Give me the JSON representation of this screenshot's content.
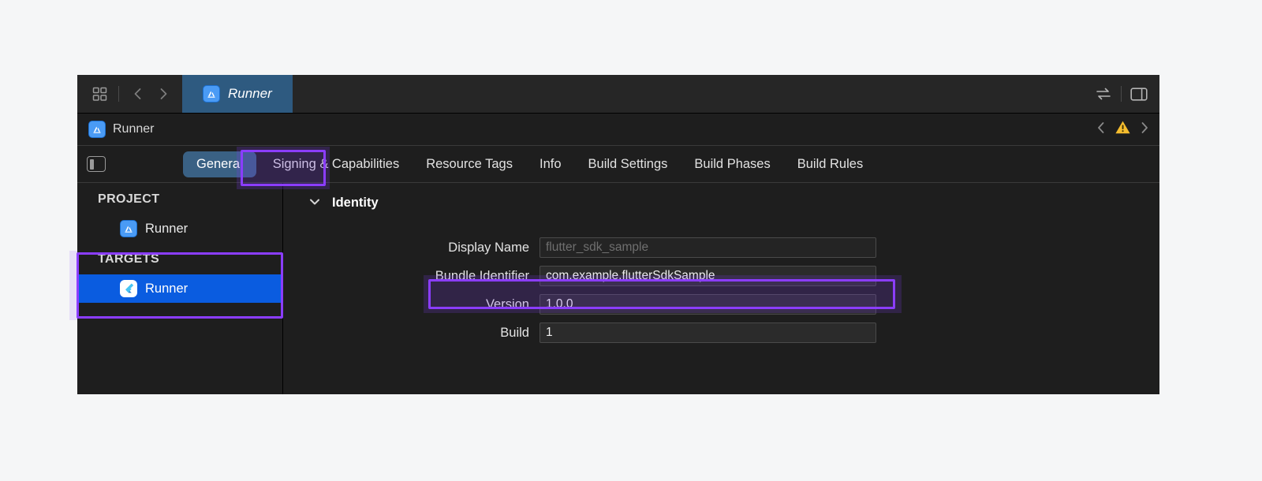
{
  "toolbar": {
    "panels_icon": "panels-grid-icon",
    "back_icon": "chevron-left-icon",
    "forward_icon": "chevron-right-icon",
    "active_tab_label": "Runner",
    "active_tab_icon": "app-store-icon",
    "swap_icon": "swap-arrows-icon",
    "inspector_icon": "right-panel-icon"
  },
  "breadcrumb": {
    "icon": "app-store-icon",
    "label": "Runner",
    "prev_icon": "chevron-left-icon",
    "warning_icon": "warning-triangle-icon",
    "next_icon": "chevron-right-icon"
  },
  "tabbar": {
    "sidebar_toggle_icon": "sidebar-toggle-icon",
    "tabs": [
      {
        "label": "General",
        "selected": true
      },
      {
        "label": "Signing & Capabilities",
        "selected": false
      },
      {
        "label": "Resource Tags",
        "selected": false
      },
      {
        "label": "Info",
        "selected": false
      },
      {
        "label": "Build Settings",
        "selected": false
      },
      {
        "label": "Build Phases",
        "selected": false
      },
      {
        "label": "Build Rules",
        "selected": false
      }
    ]
  },
  "sidebar": {
    "project_group_label": "PROJECT",
    "project_items": [
      {
        "label": "Runner",
        "icon": "app-store-icon",
        "selected": false
      }
    ],
    "targets_group_label": "TARGETS",
    "target_items": [
      {
        "label": "Runner",
        "icon": "flutter-icon",
        "selected": true
      }
    ]
  },
  "content": {
    "section_title": "Identity",
    "disclosure_icon": "chevron-down-icon",
    "fields": [
      {
        "label": "Display Name",
        "value": "",
        "placeholder": "flutter_sdk_sample",
        "muted": true
      },
      {
        "label": "Bundle Identifier",
        "value": "com.example.flutterSdkSample",
        "placeholder": "",
        "muted": false
      },
      {
        "label": "Version",
        "value": "1.0.0",
        "placeholder": "",
        "muted": false
      },
      {
        "label": "Build",
        "value": "1",
        "placeholder": "",
        "muted": false
      }
    ]
  },
  "annotations": {
    "color": "#8b3dff",
    "band_color": "#e6def7",
    "targets_box": "targets-group-highlight",
    "general_box": "general-tab-highlight",
    "bundle_box": "bundle-identifier-highlight"
  }
}
